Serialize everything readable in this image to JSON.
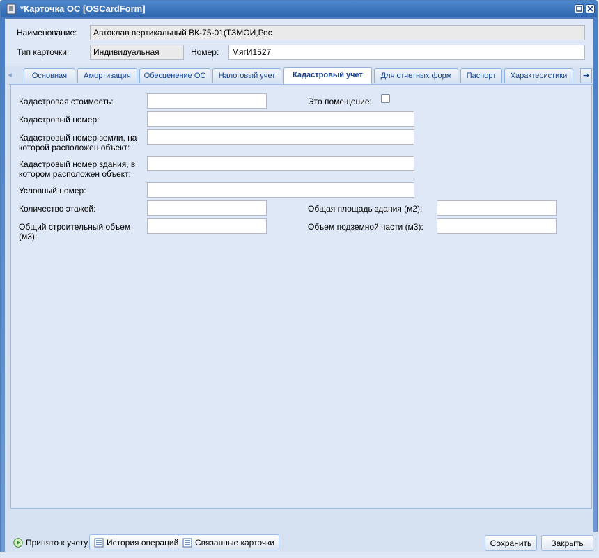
{
  "window": {
    "title": "*Карточка ОС [OSCardForm]"
  },
  "header": {
    "name_label": "Наименование:",
    "name_value": "Автоклав вертикальный ВК-75-01(ТЗМОИ,Рос",
    "card_type_label": "Тип карточки:",
    "card_type_value": "Индивидуальная",
    "number_label": "Номер:",
    "number_value": "МягИ1527"
  },
  "tabs": [
    {
      "label": "Основная"
    },
    {
      "label": "Амортизация"
    },
    {
      "label": "Обесценение ОС"
    },
    {
      "label": "Налоговый учет"
    },
    {
      "label": "Кадастровый учет"
    },
    {
      "label": "Для отчетных форм"
    },
    {
      "label": "Паспорт"
    },
    {
      "label": "Характеристики"
    }
  ],
  "active_tab": "Кадастровый учет",
  "cadastral": {
    "cost_label": "Кадастровая стоимость:",
    "cost_value": "",
    "is_room_label": "Это помещение:",
    "is_room_checked": false,
    "number_label": "Кадастровый номер:",
    "number_value": "",
    "land_number_label_1": "Кадастровый номер земли, на",
    "land_number_label_2": "которой расположен объект:",
    "land_number_value": "",
    "building_number_label_1": "Кадастровый номер здания, в",
    "building_number_label_2": "котором расположен объект:",
    "building_number_value": "",
    "conditional_number_label": "Условный номер:",
    "conditional_number_value": "",
    "floors_label": "Количество этажей:",
    "floors_value": "",
    "total_area_label": "Общая площадь здания (м2):",
    "total_area_value": "",
    "volume_label_1": "Общий строительный объем",
    "volume_label_2": "(м3):",
    "volume_value": "",
    "underground_volume_label": "Объем подземной части (м3):",
    "underground_volume_value": ""
  },
  "footer": {
    "accepted_label": "Принято к учету",
    "history_label": "История операций",
    "linked_label": "Связанные карточки",
    "save_label": "Сохранить",
    "close_label": "Закрыть"
  },
  "colors": {
    "title_bar": "#2f66ae",
    "tab_text": "#15428b",
    "panel_bg": "#dfe8f6"
  }
}
